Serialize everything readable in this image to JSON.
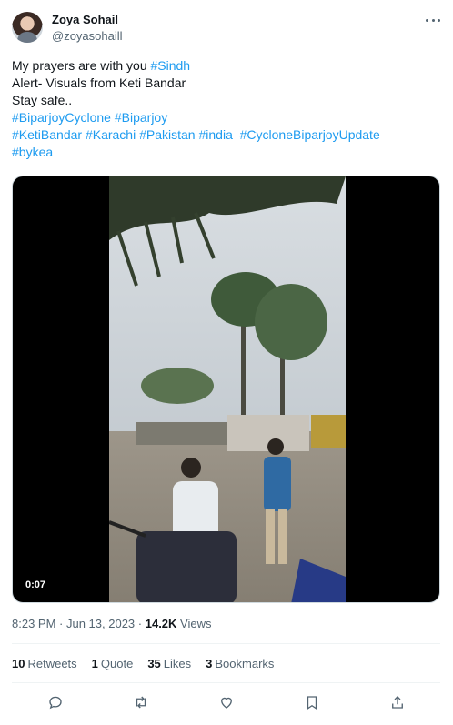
{
  "author": {
    "display_name": "Zoya Sohail",
    "handle": "@zoyasohaill"
  },
  "tweet": {
    "line1_text": "My prayers are with you ",
    "line1_tag": "#Sindh",
    "line2": "Alert- Visuals from Keti Bandar",
    "line3": "Stay safe..",
    "tags_row1": [
      "#BiparjoyCyclone",
      "#Biparjoy"
    ],
    "tags_row2": [
      "#KetiBandar",
      "#Karachi",
      "#Pakistan",
      "#india",
      "#CycloneBiparjoyUpdate"
    ],
    "tags_row3": [
      "#bykea"
    ]
  },
  "media": {
    "duration": "0:07"
  },
  "meta": {
    "time": "8:23 PM",
    "separator": " · ",
    "date": "Jun 13, 2023",
    "views_count": "14.2K",
    "views_label": " Views"
  },
  "stats": {
    "retweets_count": "10",
    "retweets_label": "Retweets",
    "quotes_count": "1",
    "quotes_label": "Quote",
    "likes_count": "35",
    "likes_label": "Likes",
    "bookmarks_count": "3",
    "bookmarks_label": "Bookmarks"
  },
  "actions": {
    "icons": [
      "reply-icon",
      "retweet-icon",
      "like-icon",
      "bookmark-icon",
      "share-icon"
    ]
  },
  "colors": {
    "link": "#1d9bf0",
    "text": "#0f1419",
    "secondary": "#536471",
    "divider": "#eff3f4"
  }
}
